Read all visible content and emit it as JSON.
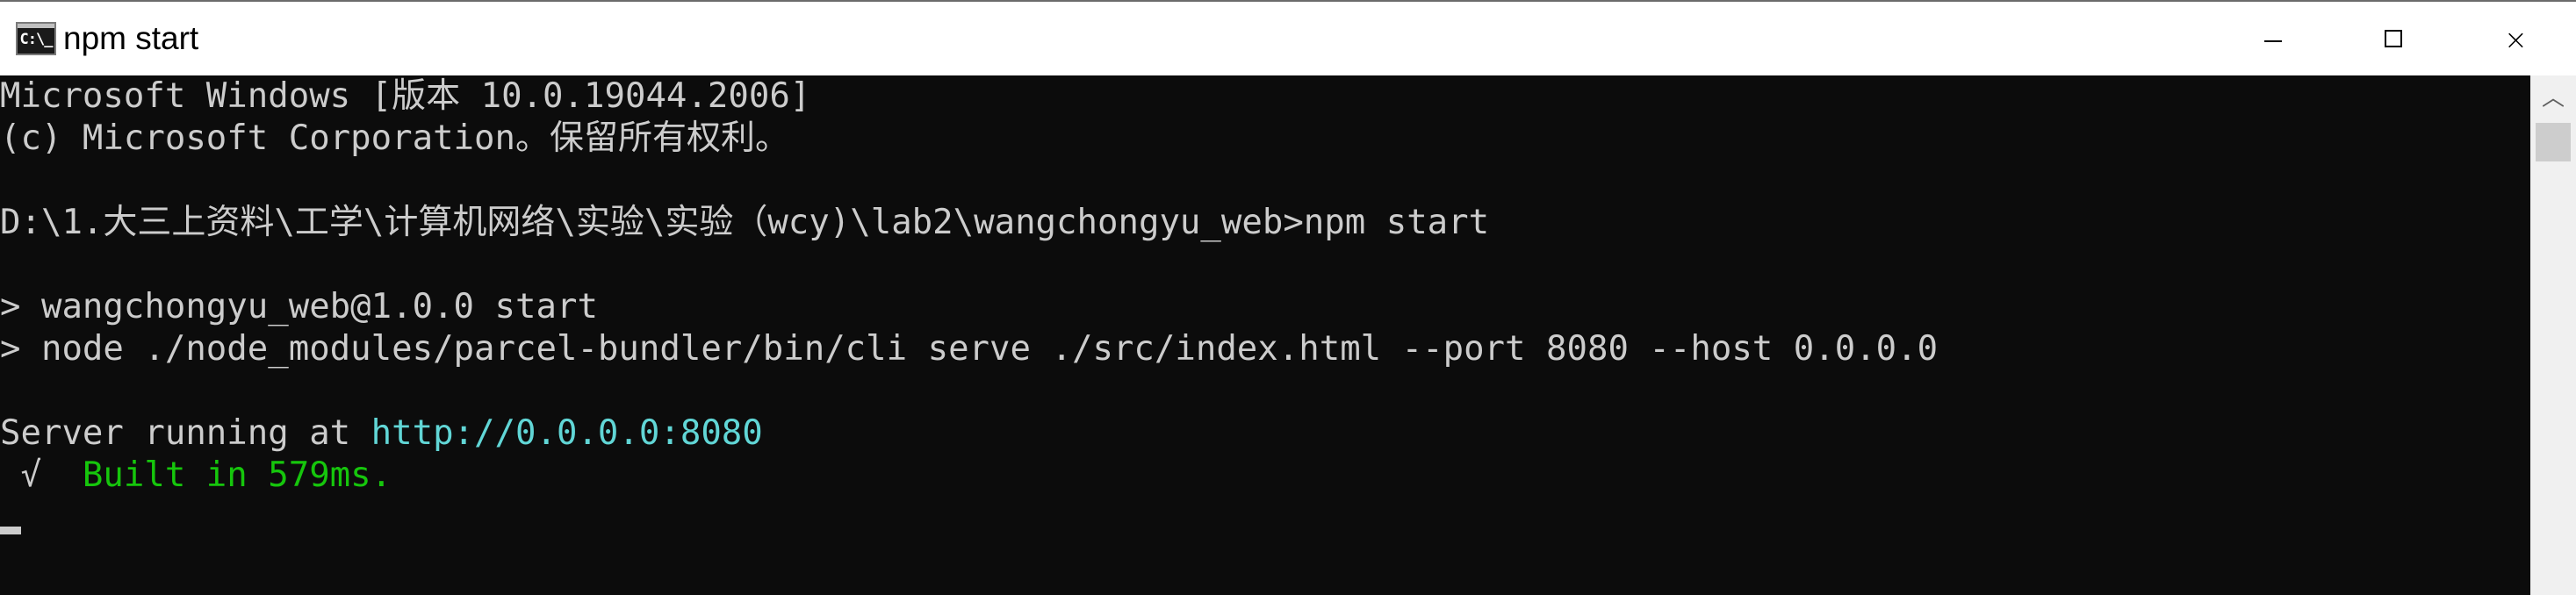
{
  "window": {
    "title": "npm start",
    "icon_text": "C:\\_"
  },
  "controls": {
    "minimize": "minimize-icon",
    "maximize": "maximize-icon",
    "close": "×"
  },
  "console": {
    "lines": {
      "l1": "Microsoft Windows [版本 10.0.19044.2006]",
      "l2": "(c) Microsoft Corporation。保留所有权利。",
      "l3": "D:\\1.大三上资料\\工学\\计算机网络\\实验\\实验（wcy)\\lab2\\wangchongyu_web>npm start",
      "l4": "> wangchongyu_web@1.0.0 start",
      "l5": "> node ./node_modules/parcel-bundler/bin/cli serve ./src/index.html --port 8080 --host 0.0.0.0",
      "l6_prefix": "Server running at ",
      "l6_url": "http://0.0.0.0:8080",
      "l7_check": " √  ",
      "l7_built": "Built in 579ms."
    }
  },
  "colors": {
    "background": "#0c0c0c",
    "text": "#cccccc",
    "url": "#61d6d6",
    "success": "#16c60c"
  },
  "scrollbar": {
    "up_arrow": "︿"
  }
}
